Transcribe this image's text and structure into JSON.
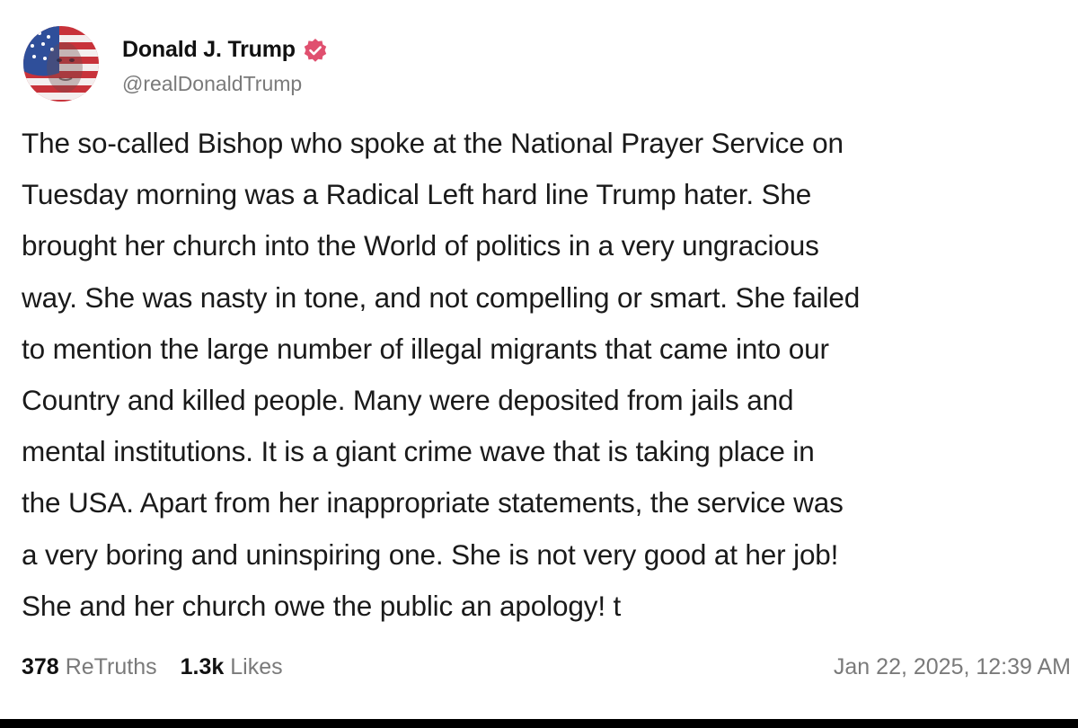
{
  "post": {
    "author": {
      "display_name": "Donald J. Trump",
      "handle": "@realDonaldTrump",
      "verified": true,
      "avatar_icon": "avatar-flag-portrait-icon",
      "verified_icon": "verified-badge-icon",
      "verified_color": "#e0506f"
    },
    "body_lines": [
      "The so-called Bishop who spoke at the National Prayer Service on",
      "Tuesday morning was a Radical Left hard line Trump hater. She",
      "brought her church into the World of politics in a very ungracious",
      "way. She was nasty in tone, and not compelling or smart. She failed",
      "to mention the large number of illegal migrants that came into our",
      "Country and killed people. Many were deposited from jails and",
      "mental institutions. It is a giant crime wave that is taking place in",
      "the USA. Apart from her inappropriate statements, the service was",
      "a very boring and uninspiring one. She is not very good at her job!",
      "She and her church owe the public an apology! t"
    ],
    "stats": {
      "retruths_count": "378",
      "retruths_label": "ReTruths",
      "likes_count": "1.3k",
      "likes_label": "Likes"
    },
    "timestamp": "Jan 22, 2025, 12:39 AM"
  },
  "colors": {
    "text": "#1a1a1a",
    "muted": "#7a7a7a",
    "background": "#ffffff",
    "bottom_bar": "#000000"
  }
}
